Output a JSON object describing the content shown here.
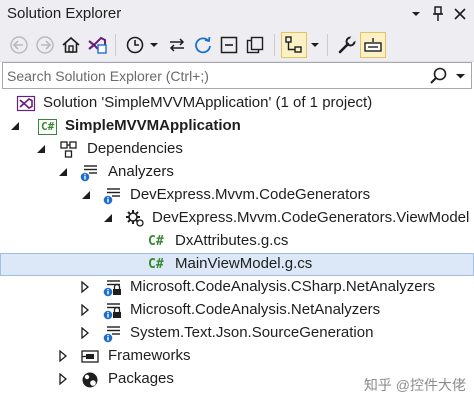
{
  "window": {
    "title": "Solution Explorer"
  },
  "toolbar": {
    "items": [
      {
        "icon": "back-arrow-icon"
      },
      {
        "icon": "forward-arrow-icon"
      },
      {
        "icon": "home-icon"
      },
      {
        "icon": "visual-studio-switch-view-icon"
      },
      {
        "icon": "pending-changes-clock-icon"
      },
      {
        "icon": "sync-with-active-document-icon"
      },
      {
        "icon": "refresh-icon"
      },
      {
        "icon": "collapse-all-icon"
      },
      {
        "icon": "show-all-files-icon"
      },
      {
        "icon": "preview-selected-items-icon"
      },
      {
        "icon": "properties-wrench-icon"
      },
      {
        "icon": "toggle-preview-icon"
      }
    ]
  },
  "search": {
    "placeholder": "Search Solution Explorer (Ctrl+;)"
  },
  "tree": {
    "solution": "Solution 'SimpleMVVMApplication' (1 of 1 project)",
    "project": "SimpleMVVMApplication",
    "project_badge": "C#",
    "dependencies": "Dependencies",
    "analyzers": "Analyzers",
    "codegen": "DevExpress.Mvvm.CodeGenerators",
    "viewmodel": "DevExpress.Mvvm.CodeGenerators.ViewModel",
    "file1": "DxAttributes.g.cs",
    "file2": "MainViewModel.g.cs",
    "file_badge": "C#",
    "csharp_analyzers": "Microsoft.CodeAnalysis.CSharp.NetAnalyzers",
    "net_analyzers": "Microsoft.CodeAnalysis.NetAnalyzers",
    "sourcegen": "System.Text.Json.SourceGeneration",
    "frameworks": "Frameworks",
    "packages": "Packages"
  },
  "watermark": "知乎 @控件大佬",
  "colors": {
    "chrome": "#eeeef2",
    "selection": "#dce8f7",
    "csharp": "#368832",
    "vs_purple": "#68217a",
    "blue": "#1e6fcc"
  }
}
